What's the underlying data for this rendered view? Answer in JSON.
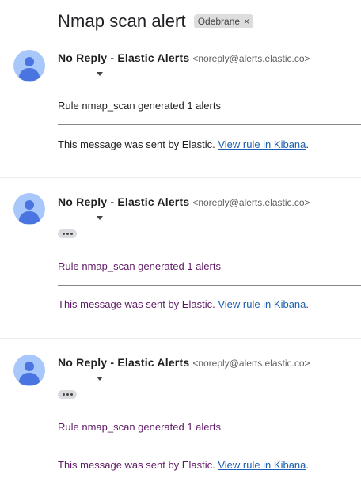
{
  "subject": "Nmap scan alert",
  "label": {
    "text": "Odebrane",
    "remove_glyph": "×"
  },
  "messages": [
    {
      "sender_name": "No Reply - Elastic Alerts",
      "sender_email": "<noreply@alerts.elastic.co>",
      "body": "Rule nmap_scan generated 1 alerts",
      "footer_text": "This message was sent by Elastic.",
      "footer_link": "View rule in Kibana",
      "footer_end": "."
    },
    {
      "sender_name": "No Reply - Elastic Alerts",
      "sender_email": "<noreply@alerts.elastic.co>",
      "body": "Rule nmap_scan generated 1 alerts",
      "footer_text": "This message was sent by Elastic.",
      "footer_link": "View rule in Kibana",
      "footer_end": "."
    },
    {
      "sender_name": "No Reply - Elastic Alerts",
      "sender_email": "<noreply@alerts.elastic.co>",
      "body": "Rule nmap_scan generated 1 alerts",
      "footer_text": "This message was sent by Elastic.",
      "footer_link": "View rule in Kibana",
      "footer_end": "."
    }
  ],
  "colors": {
    "avatar_bg": "#a8c7fa",
    "avatar_fg": "#4a74e0",
    "link": "#1a5fb4",
    "quoted_text": "#5f1a67"
  }
}
